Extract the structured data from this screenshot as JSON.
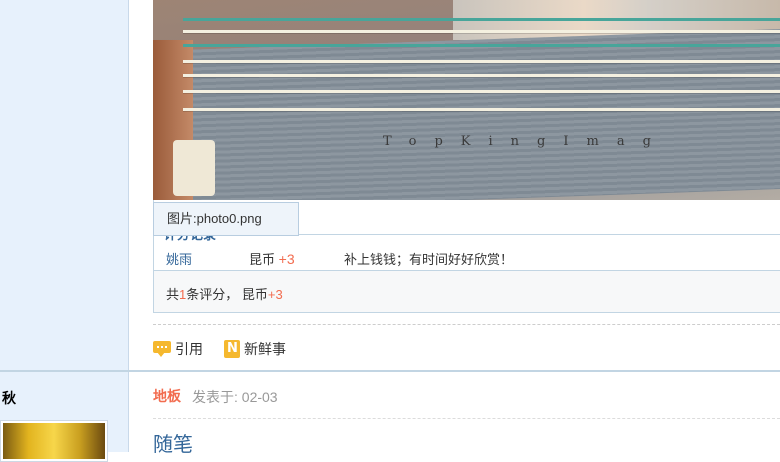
{
  "image_tooltip": "图片:photo0.png",
  "photo_watermark": "TopKingImag",
  "rating": {
    "title": "评分记录",
    "rows": [
      {
        "user": "姚雨",
        "currency": "昆币",
        "amount": "+3",
        "reason": "补上钱钱；有时间好好欣赏！"
      }
    ],
    "total_prefix": "共",
    "total_count": "1",
    "total_mid": "条评分，  昆币",
    "total_amount": "+3"
  },
  "actions": {
    "quote": "引用",
    "news": "新鲜事"
  },
  "next_post": {
    "author": "秋",
    "floor": "地板",
    "posted": "发表于: 02-03",
    "title": "随笔"
  }
}
